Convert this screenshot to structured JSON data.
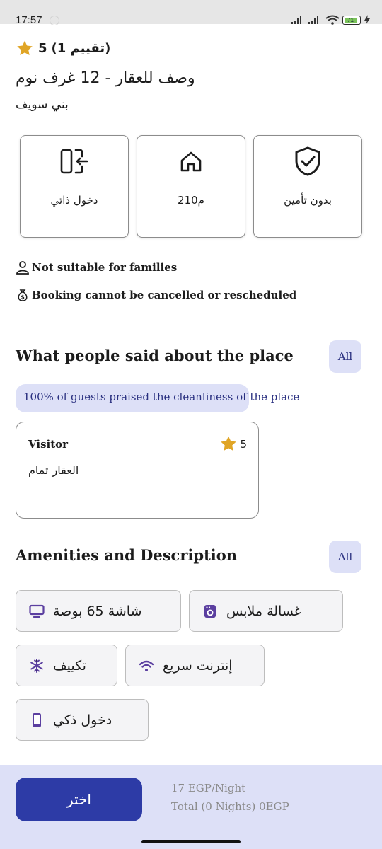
{
  "status_bar": {
    "time": "17:57",
    "battery": "71"
  },
  "header": {
    "rating_value": "5",
    "rating_label": "(تقييم 1)",
    "title": "وصف للعقار - 12 غرف نوم",
    "location": "بني سويف"
  },
  "info_cards": [
    {
      "label": "بدون تأمين",
      "icon": "shield-check-icon"
    },
    {
      "label": "210م",
      "icon": "house-icon"
    },
    {
      "label": "دخول ذاتي",
      "icon": "self-entry-icon"
    }
  ],
  "notes": {
    "families": "Not suitable for families",
    "cancellation": "Booking cannot be cancelled or rescheduled"
  },
  "reviews": {
    "section_title": "What people said about the place",
    "all_label": "All",
    "cleanliness": "100% of guests praised the cleanliness of the place",
    "items": [
      {
        "author": "Visitor",
        "stars": "5",
        "text": "العقار تمام"
      }
    ]
  },
  "amenities": {
    "section_title": "Amenities and Description",
    "all_label": "All",
    "items": [
      {
        "label": "غسالة ملابس",
        "icon": "washing-machine-icon"
      },
      {
        "label": "شاشة 65 بوصة",
        "icon": "monitor-icon"
      },
      {
        "label": "إنترنت سريع",
        "icon": "wifi-icon"
      },
      {
        "label": "تكييف",
        "icon": "snowflake-icon"
      },
      {
        "label": "دخول ذكي",
        "icon": "smartphone-icon"
      }
    ]
  },
  "bottom_bar": {
    "choose_label": "اختر",
    "price": "17 EGP/Night",
    "total": "Total (0 Nights) 0EGP"
  },
  "colors": {
    "accent": "#2d3ba6",
    "accent_light": "#dde0f7",
    "star": "#e0a526",
    "icon_purple": "#5b3fa0"
  }
}
